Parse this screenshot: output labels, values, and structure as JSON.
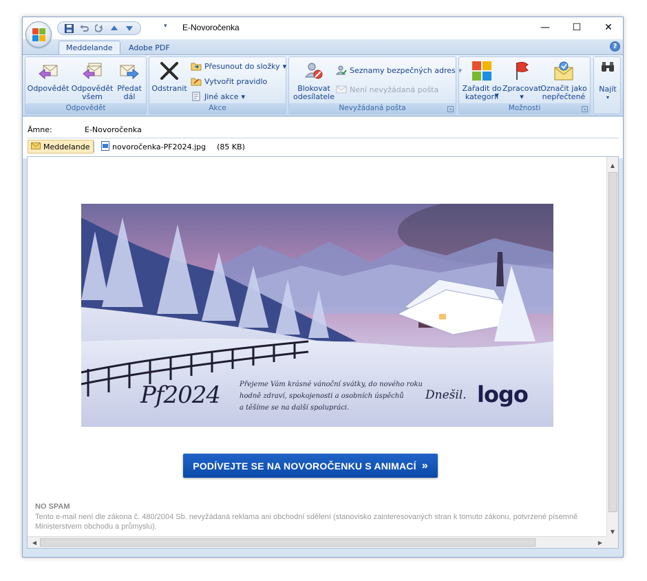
{
  "window": {
    "title": "E-Novoročenka",
    "controls": {
      "minimize": "—",
      "maximize": "☐",
      "close": "✕"
    }
  },
  "quick_access": {
    "items": [
      {
        "icon": "save-icon"
      },
      {
        "icon": "undo-icon"
      },
      {
        "icon": "redo-icon"
      },
      {
        "icon": "arrow-up-icon"
      },
      {
        "icon": "arrow-down-icon"
      }
    ],
    "dropdown": "▾"
  },
  "tabs": [
    {
      "label": "Meddelande",
      "active": true
    },
    {
      "label": "Adobe PDF",
      "active": false
    }
  ],
  "help": "?",
  "ribbon": {
    "groups": {
      "respond": {
        "label": "Odpovědět",
        "buttons": [
          {
            "label": "Odpovědět",
            "icon": "reply-icon"
          },
          {
            "label": "Odpovědět všem",
            "icon": "reply-all-icon"
          },
          {
            "label": "Předat dál",
            "icon": "forward-icon"
          }
        ]
      },
      "actions": {
        "label": "Akce",
        "delete": "Odstranit",
        "move": "Přesunout do složky",
        "create_rule": "Vytvořit pravidlo",
        "other": "Jiné akce"
      },
      "junk": {
        "label": "Nevyžádaná pošta",
        "block": "Blokovat odesílatele",
        "safe_lists": "Seznamy bezpečných adres",
        "not_junk": "Není nevyžádaná pošta"
      },
      "options": {
        "label": "Možnosti",
        "categorize": "Zařadit do kategorií",
        "follow_up": "Zpracovat",
        "mark_unread": "Označit jako nepřečtené"
      },
      "find": {
        "label": "Najít"
      }
    }
  },
  "header": {
    "subject_label": "Ämne:",
    "subject_value": "E-Novoročenka",
    "message_tab": "Meddelande",
    "attachment_name": "novoročenka-PF2024.jpg",
    "attachment_size": "(85 KB)"
  },
  "card": {
    "pf_text": "Pf2024",
    "greeting": [
      "Přejeme Vám krásné vánoční svátky, do nového roku",
      "hodně zdraví, spokojenosti a osobních úspěchů",
      "a těšíme se na další spolupráci."
    ],
    "signature": "Dnešil.",
    "logo": "logo"
  },
  "cta": {
    "label": "PODÍVEJTE SE NA NOVOROČENKU S ANIMACÍ",
    "arrow": "»"
  },
  "nospam": {
    "title": "NO SPAM",
    "line1": "Tento e-mail není dle zákona č. 480/2004 Sb. nevyžádaná reklama ani obchodní sdělení (stanovisko zainteresovaných stran k tomuto zákonu, potvrzené písemně",
    "line2": "Ministerstvem obchodu a průmyslu)."
  },
  "colors": {
    "accent": "#15428b",
    "cta_bg": "#1558bd",
    "ribbon_bg": "#d4e3f4"
  }
}
